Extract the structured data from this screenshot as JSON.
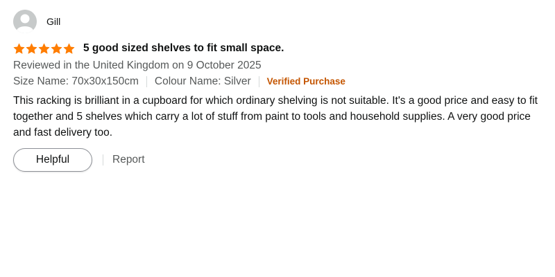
{
  "profile": {
    "name": "Gill",
    "avatar_icon": "user-silhouette-icon"
  },
  "rating": {
    "stars": 5,
    "max": 5,
    "color": "#ff7d00",
    "icon": "star-icon"
  },
  "review": {
    "title": "5 good sized shelves to fit small space.",
    "date_line": "Reviewed in the United Kingdom on 9 October 2025",
    "size": "Size Name: 70x30x150cm",
    "colour": "Colour Name: Silver",
    "verified": "Verified Purchase",
    "body": "This racking is brilliant in a cupboard for which ordinary shelving is not suitable. It's a good price and easy to fit together and 5 shelves which carry a lot of stuff from paint to tools and household supplies. A very good price and fast delivery too."
  },
  "actions": {
    "helpful_label": "Helpful",
    "report_label": "Report"
  },
  "colors": {
    "verified": "#c45500",
    "secondary_text": "#565959",
    "primary_text": "#0f1111"
  }
}
